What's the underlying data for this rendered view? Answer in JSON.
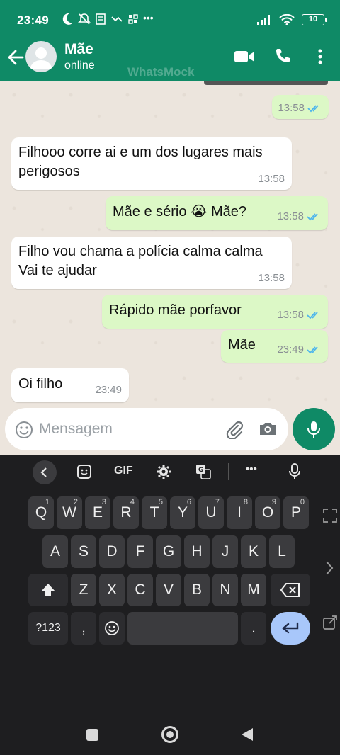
{
  "status_bar": {
    "time": "23:49",
    "battery": "10"
  },
  "header": {
    "contact_name": "Mãe",
    "presence": "online",
    "watermark": "WhatsMock"
  },
  "messages": [
    {
      "dir": "out",
      "text": "",
      "time": "13:58",
      "read": true
    },
    {
      "dir": "in",
      "text": "Filhooo corre ai e um dos lugares mais perigosos",
      "time": "13:58"
    },
    {
      "dir": "out",
      "text": "Mãe e sério 😭 Mãe?",
      "time": "13:58",
      "read": true
    },
    {
      "dir": "in",
      "text": "Filho vou chama a polícia calma calma Vai te ajudar",
      "time": "13:58"
    },
    {
      "dir": "out",
      "text": "Rápido mãe porfavor",
      "time": "13:58",
      "read": true
    },
    {
      "dir": "out",
      "text": "Mãe",
      "time": "23:49",
      "read": true
    },
    {
      "dir": "in",
      "text": "Oi filho",
      "time": "23:49"
    }
  ],
  "composer": {
    "placeholder": "Mensagem"
  },
  "keyboard": {
    "toolbar": {
      "gif": "GIF",
      "more": "•••"
    },
    "row1": [
      {
        "k": "Q",
        "s": "1"
      },
      {
        "k": "W",
        "s": "2"
      },
      {
        "k": "E",
        "s": "3"
      },
      {
        "k": "R",
        "s": "4"
      },
      {
        "k": "T",
        "s": "5"
      },
      {
        "k": "Y",
        "s": "6"
      },
      {
        "k": "U",
        "s": "7"
      },
      {
        "k": "I",
        "s": "8"
      },
      {
        "k": "O",
        "s": "9"
      },
      {
        "k": "P",
        "s": "0"
      }
    ],
    "row2": [
      "A",
      "S",
      "D",
      "F",
      "G",
      "H",
      "J",
      "K",
      "L"
    ],
    "row3": [
      "Z",
      "X",
      "C",
      "V",
      "B",
      "N",
      "M"
    ],
    "symbols": "?123",
    "comma": ",",
    "period": "."
  },
  "colors": {
    "brand_green": "#0f8a66",
    "outgoing_bubble": "#dcf8c6",
    "incoming_bubble": "#ffffff",
    "read_ticks": "#4fb6ec",
    "enter_key": "#a8c7fa"
  }
}
